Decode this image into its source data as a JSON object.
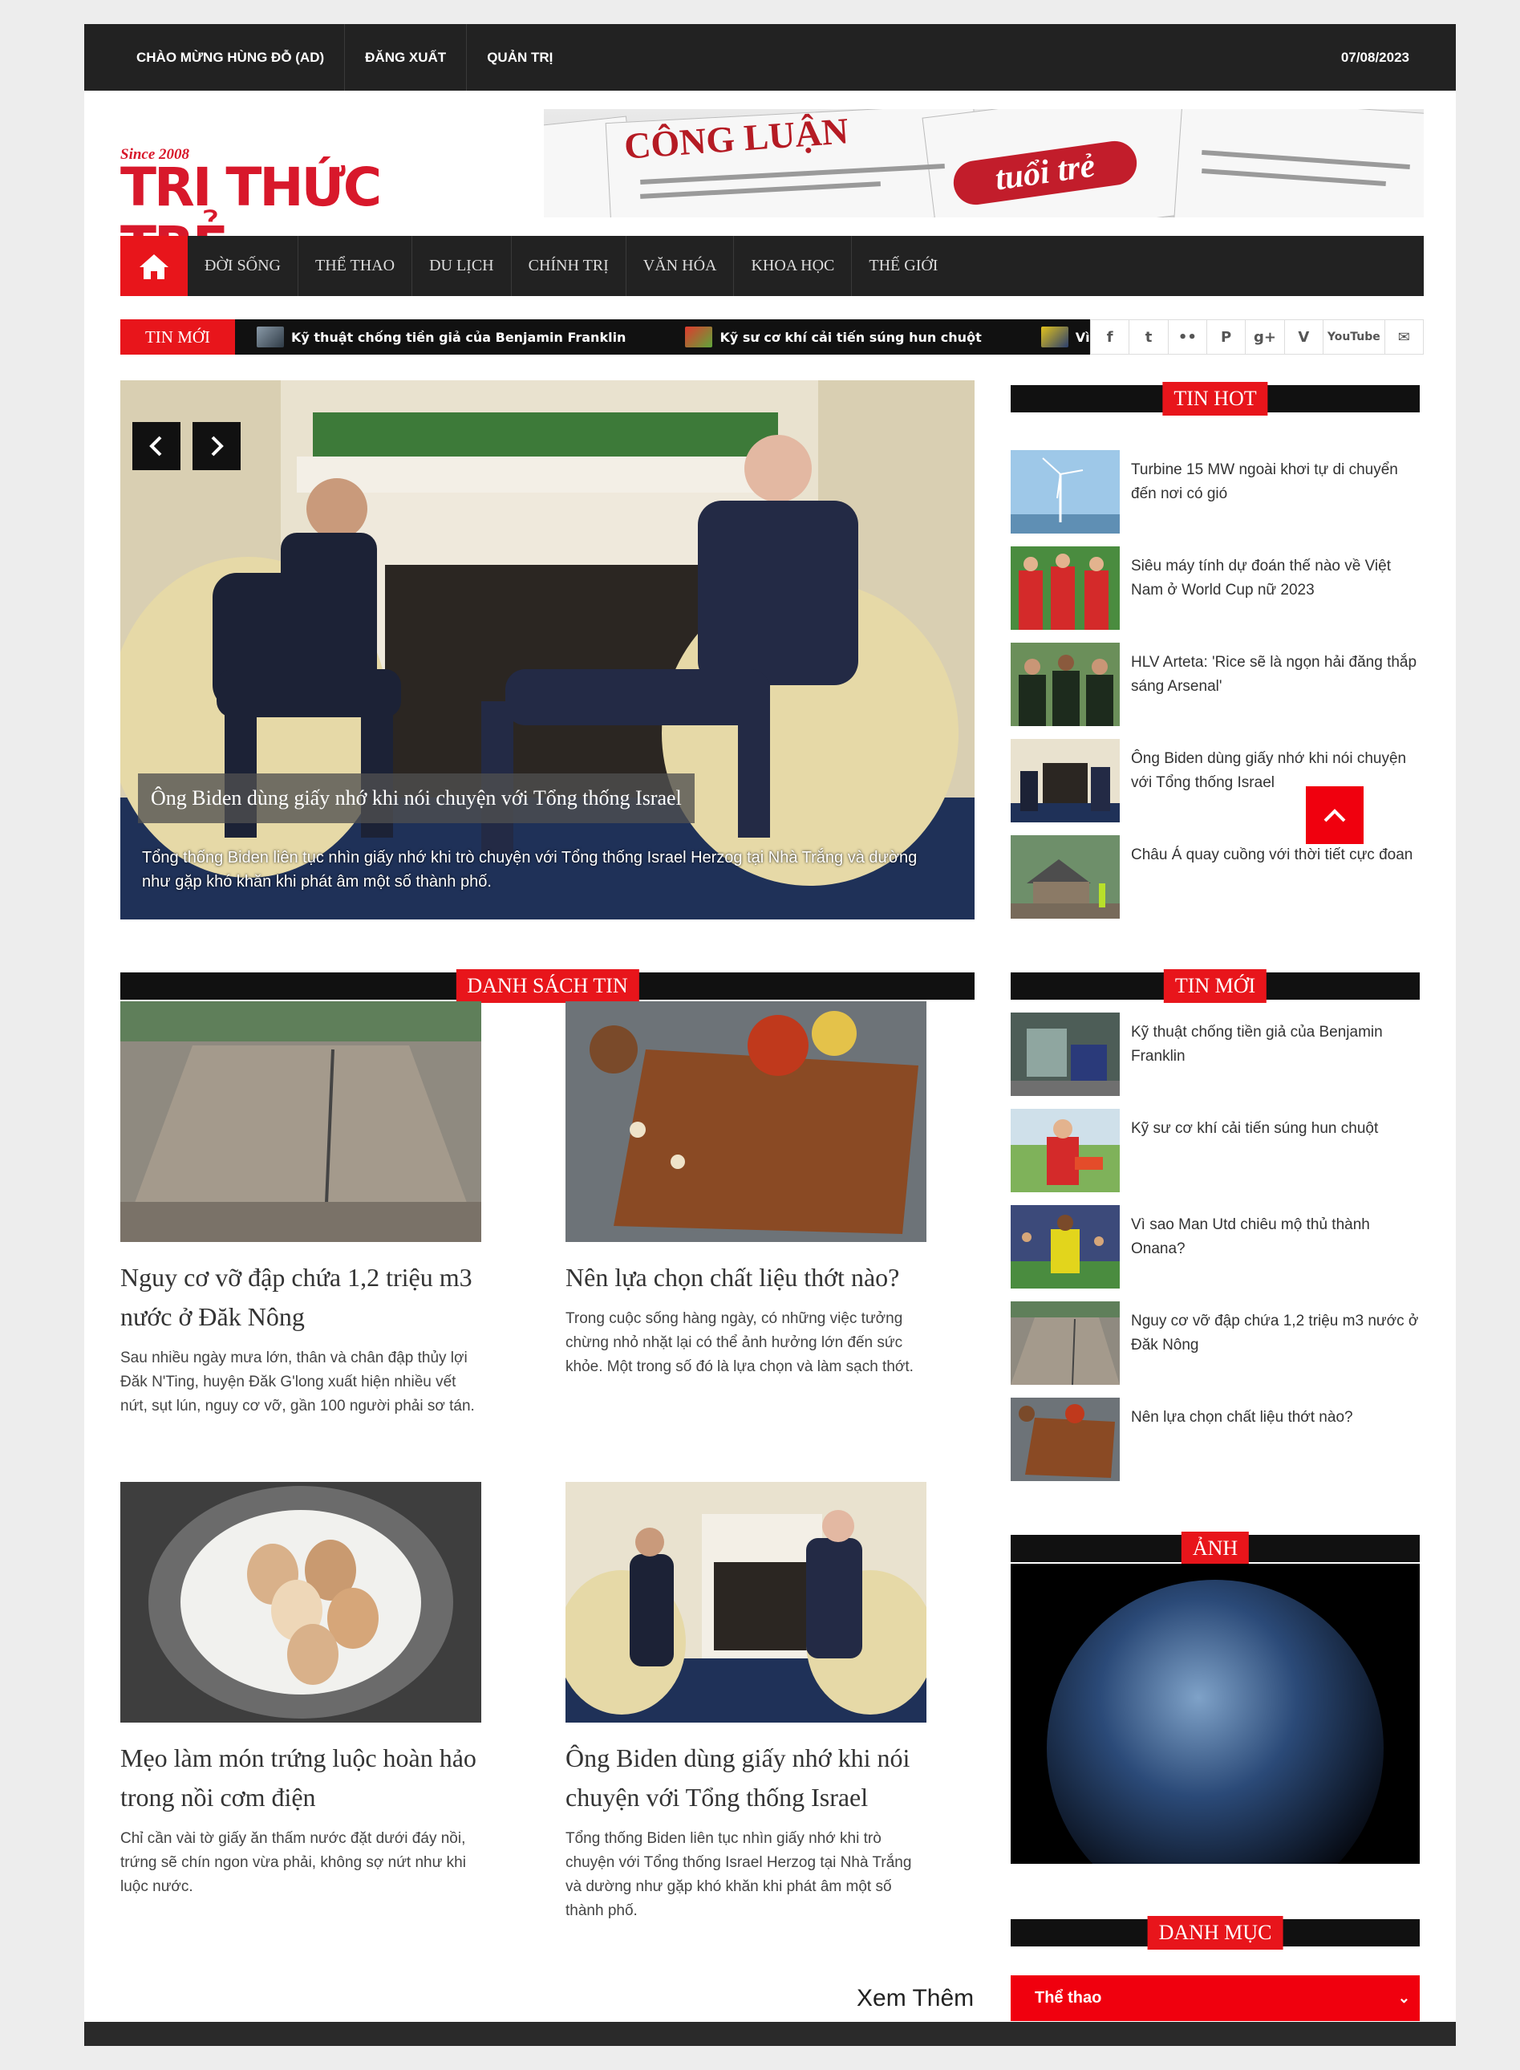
{
  "topbar": {
    "links": [
      "CHÀO MỪNG HÙNG ĐỖ (AD)",
      "ĐĂNG XUẤT",
      "QUẢN TRỊ"
    ],
    "date": "07/08/2023"
  },
  "logo": {
    "since": "Since 2008",
    "name": "TRI THỨC TRẺ"
  },
  "banner": {
    "paper1": "CÔNG LUẬN",
    "paper2": "tuổi trẻ"
  },
  "nav": {
    "home_icon": "home-icon",
    "items": [
      "ĐỜI SỐNG",
      "THỂ THAO",
      "DU LỊCH",
      "CHÍNH TRỊ",
      "VĂN HÓA",
      "KHOA HỌC",
      "THẾ GIỚI"
    ]
  },
  "ticker": {
    "label": "TIN MỚI",
    "items": [
      "Kỹ thuật chống tiền giả của Benjamin Franklin",
      "Kỹ sư cơ khí cải tiến súng hun chuột",
      "Vì sao M"
    ]
  },
  "social": {
    "icons": [
      "facebook-icon",
      "twitter-icon",
      "flickr-icon",
      "pinterest-icon",
      "google-plus-icon",
      "vimeo-icon",
      "youtube-icon",
      "mail-icon"
    ],
    "labels": [
      "f",
      "t",
      "••",
      "P",
      "g+",
      "V",
      "YouTube",
      "✉"
    ]
  },
  "slider": {
    "title": "Ông Biden dùng giấy nhớ khi nói chuyện với Tổng thống Israel",
    "text": "Tổng thống Biden liên tục nhìn giấy nhớ khi trò chuyện với Tổng thống Israel Herzog tại Nhà Trắng và dường như gặp khó khăn khi phát âm một số thành phố."
  },
  "tin_hot": {
    "title": "TIN HOT",
    "items": [
      "Turbine 15 MW ngoài khơi tự di chuyển đến nơi có gió",
      "Siêu máy tính dự đoán thế nào về Việt Nam ở World Cup nữ 2023",
      "HLV Arteta: 'Rice sẽ là ngọn hải đăng thắp sáng Arsenal'",
      "Ông Biden dùng giấy nhớ khi nói chuyện với Tổng thống Israel",
      "Châu Á quay cuồng với thời tiết cực đoan"
    ]
  },
  "danh_sach_tin": {
    "title": "DANH SÁCH TIN",
    "cards": [
      {
        "title": "Nguy cơ vỡ đập chứa 1,2 triệu m3 nước ở Đăk Nông",
        "desc": "Sau nhiều ngày mưa lớn, thân và chân đập thủy lợi Đăk N'Ting, huyện Đăk G'long xuất hiện nhiều vết nứt, sụt lún, nguy cơ vỡ, gần 100 người phải sơ tán."
      },
      {
        "title": "Nên lựa chọn chất liệu thớt nào?",
        "desc": "Trong cuộc sống hàng ngày, có những việc tưởng chừng nhỏ nhặt lại có thể ảnh hưởng lớn đến sức khỏe. Một trong số đó là lựa chọn và làm sạch thớt."
      },
      {
        "title": "Mẹo làm món trứng luộc hoàn hảo trong nồi cơm điện",
        "desc": "Chỉ cần vài tờ giấy ăn thấm nước đặt dưới đáy nồi, trứng sẽ chín ngon vừa phải, không sợ nứt như khi luộc nước."
      },
      {
        "title": "Ông Biden dùng giấy nhớ khi nói chuyện với Tổng thống Israel",
        "desc": "Tổng thống Biden liên tục nhìn giấy nhớ khi trò chuyện với Tổng thống Israel Herzog tại Nhà Trắng và dường như gặp khó khăn khi phát âm một số thành phố."
      }
    ],
    "more": "Xem Thêm"
  },
  "tin_moi": {
    "title": "TIN MỚI",
    "items": [
      "Kỹ thuật chống tiền giả của Benjamin Franklin",
      "Kỹ sư cơ khí cải tiến súng hun chuột",
      "Vì sao Man Utd chiêu mộ thủ thành Onana?",
      "Nguy cơ vỡ đập chứa 1,2 triệu m3 nước ở Đăk Nông",
      "Nên lựa chọn chất liệu thớt nào?"
    ]
  },
  "anh": {
    "title": "ẢNH"
  },
  "danh_muc": {
    "title": "DANH MỤC",
    "selected": "Thể thao"
  },
  "colors": {
    "accent": "#e8151b",
    "dark": "#222222"
  }
}
